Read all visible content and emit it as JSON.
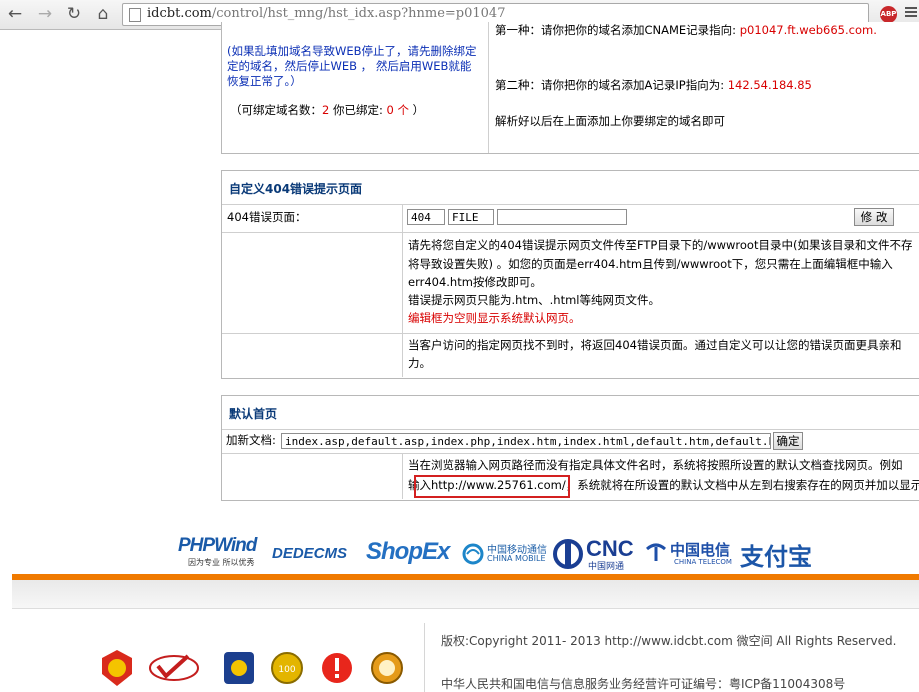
{
  "browser": {
    "url_host": "idcbt.com",
    "url_path": "/control/hst_mng/hst_idx.asp?hnme=p01047",
    "extension_badge": "ABP"
  },
  "binding": {
    "warning_lines": [
      "(如果乱填加域名导致WEB停止了，请先删除绑定",
      "定的域名，然后停止WEB ， 然后启用WEB就能",
      "恢复正常了。）"
    ],
    "count_prefix": "（可绑定域名数：",
    "count_total": "2",
    "count_mid": " 你已绑定: ",
    "count_used": "0 个",
    "count_suffix": " ）",
    "method1_label": "第一种：请你把你的域名添加CNAME记录指向: ",
    "method1_value": "p01047.ft.web665.com.",
    "method2_label": "第二种：请你把你的域名添加A记录IP指向为: ",
    "method2_value": "142.54.184.85",
    "method_note": "解析好以后在上面添加上你要绑定的域名即可"
  },
  "custom404": {
    "title": "自定义404错误提示页面",
    "field_label": "404错误页面：",
    "code_value": "404",
    "type_value": "FILE",
    "path_value": "",
    "modify_button": "修 改",
    "desc_line1": "请先将您自定义的404错误提示网页文件传至FTP目录下的/wwwroot目录中(如果该目录和文件不存",
    "desc_line2": "将导致设置失败) 。如您的页面是err404.htm且传到/wwwroot下，您只需在上面编辑框中输入",
    "desc_line3": "err404.htm按修改即可。",
    "desc_line4": "错误提示网页只能为.htm、.html等纯网页文件。",
    "desc_red": "编辑框为空则显示系统默认网页。",
    "info_line1": "当客户访问的指定网页找不到时，将返回404错误页面。通过自定义可以让您的错误页面更具亲和",
    "info_line2": "力。"
  },
  "default_page": {
    "title": "默认首页",
    "add_label": "加新文档:",
    "docs_value": "index.asp,default.asp,index.php,index.htm,index.html,default.htm,default.html",
    "confirm_button": "确定",
    "desc_line1": "当在浏览器输入网页路径而没有指定具体文件名时，系统将按照所设置的默认文档查找网页。例如",
    "desc_line2_prefix": "输入",
    "desc_line2_url": "http://www.25761.com/",
    "desc_line2_suffix": "，系统就将在所设置的默认文档中从左到右搜索存在的网页并加以显示"
  },
  "logos": {
    "phpwind": "PHPWind",
    "phpwind_sub": "因为专业 所以优秀",
    "dedecms": "DEDECMS",
    "shopex": "ShopEx",
    "cmcc": "中国移动通信",
    "cmcc_en": "CHINA MOBILE",
    "cnc": "CNC",
    "cnc_sub": "中国网通",
    "telecom": "中国电信",
    "telecom_en": "CHINA TELECOM",
    "alipay": "支付宝"
  },
  "footer": {
    "copyright": "版权:Copyright 2011- 2013 http://www.idcbt.com 微空间 All Rights Reserved.",
    "license": "中华人民共和国电信与信息服务业务经营许可证编号：粤ICP备11004308号"
  }
}
